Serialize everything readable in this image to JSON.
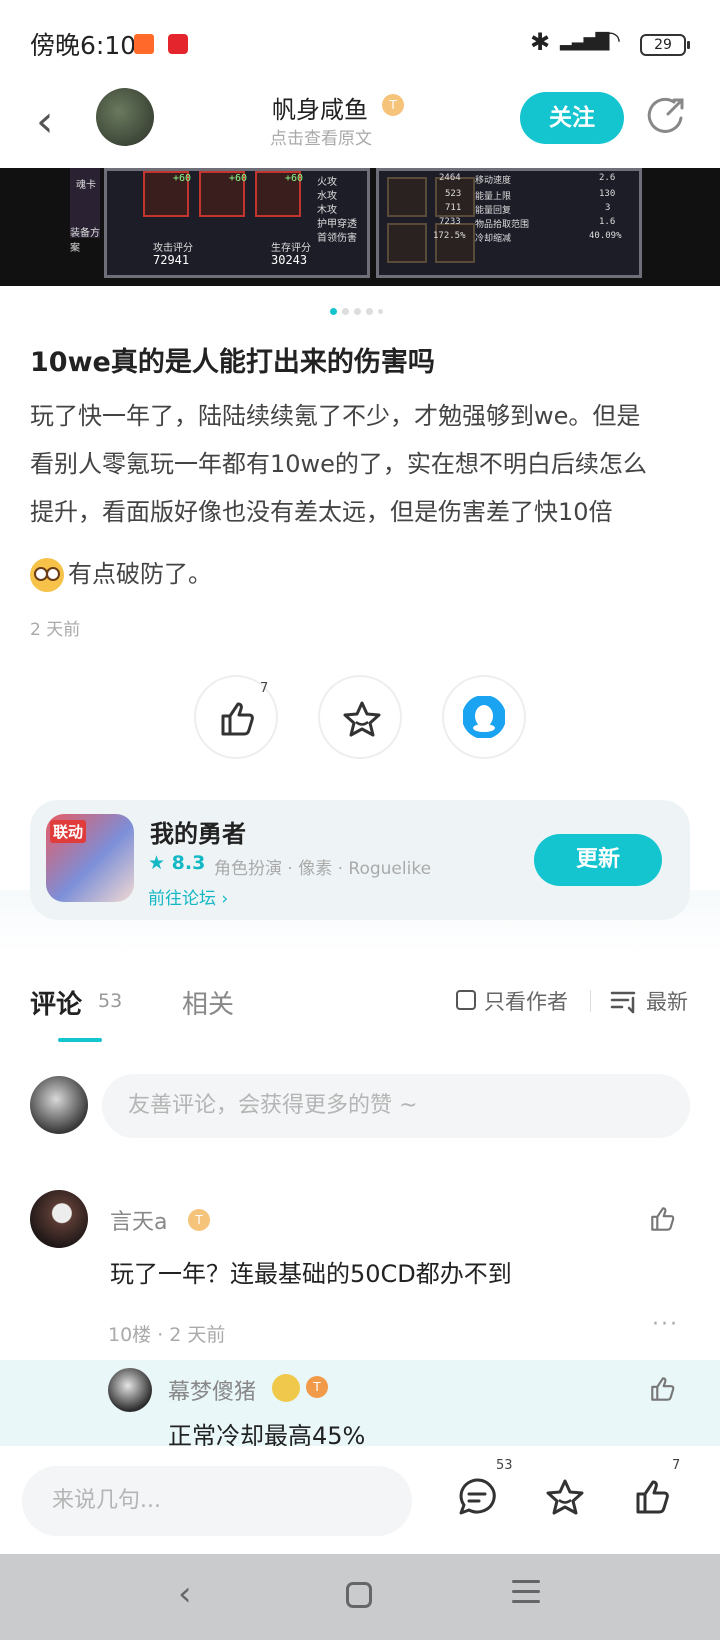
{
  "status_bar": {
    "time": "傍晚6:10",
    "battery": "29"
  },
  "header": {
    "author_name": "帆身咸鱼",
    "author_level": "T",
    "view_original": "点击查看原文",
    "follow_label": "关注",
    "icons": [
      "back-arrow-icon",
      "share-icon"
    ]
  },
  "banner": {
    "attack_label": "攻击评分",
    "attack_value": "72941",
    "survival_label": "生存评分",
    "survival_value": "30243",
    "plus_tags": [
      "+60",
      "+60",
      "+60"
    ],
    "side_labels": [
      "火攻",
      "水攻",
      "木攻",
      "护甲穿透",
      "首领伤害"
    ],
    "left_labels": [
      "魂卡",
      "装备方案"
    ],
    "stat_names": [
      "移动速度",
      "能量上限",
      "能量回复",
      "物品拾取范围",
      "冷却缩减"
    ],
    "stat_left_values": [
      "2464",
      "523",
      "711",
      "7233",
      "172.5%"
    ],
    "stat_right_values": [
      "2.6",
      "130",
      "3",
      "1.6",
      "40.09%"
    ]
  },
  "post": {
    "title": "10we真的是人能打出来的伤害吗",
    "body_line1": "玩了快一年了，陆陆续续氪了不少，才勉强够到we。但是",
    "body_line2": "看别人零氪玩一年都有10we的了，实在想不明白后续怎么",
    "body_line3": "提升，看面版好像也没有差太远，但是伤害差了快10倍",
    "body_line4": "有点破防了。",
    "time": "2 天前",
    "like_count": "7"
  },
  "game_card": {
    "name": "我的勇者",
    "badge": "联动",
    "rating": "8.3",
    "tags": "角色扮演 · 像素 · Roguelike",
    "forum_link": "前往论坛",
    "update_label": "更新"
  },
  "tabs": {
    "comment_label": "评论",
    "comment_count": "53",
    "related_label": "相关",
    "only_author": "只看作者",
    "sort_label": "最新"
  },
  "comment_input": {
    "placeholder": "友善评论，会获得更多的赞 ~"
  },
  "comment": {
    "name": "言天a",
    "level": "T",
    "text": "玩了一年？连最基础的50CD都办不到",
    "meta": "10楼 · 2 天前"
  },
  "reply": {
    "name": "幕梦傻猪",
    "level": "T",
    "text": "正常冷却最高45%"
  },
  "bottom_bar": {
    "placeholder": "来说几句...",
    "comment_count": "53",
    "like_count": "7"
  },
  "colors": {
    "accent": "#14c4cf",
    "badge": "#f5c37a"
  }
}
